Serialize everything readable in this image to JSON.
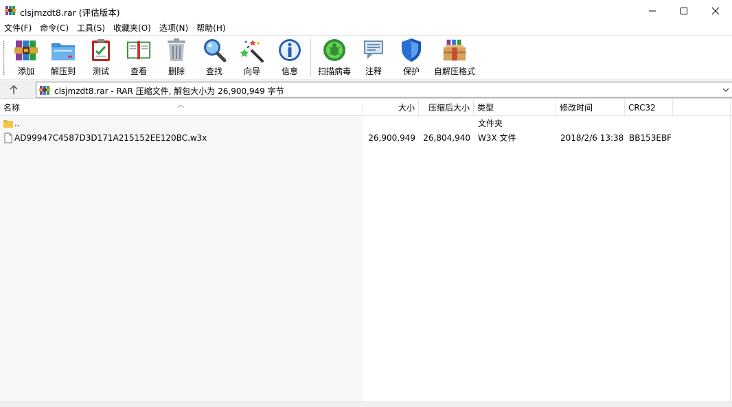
{
  "window": {
    "title": "clsjmzdt8.rar (评估版本)"
  },
  "menu": [
    {
      "label": "文件(F)"
    },
    {
      "label": "命令(C)"
    },
    {
      "label": "工具(S)"
    },
    {
      "label": "收藏夹(O)"
    },
    {
      "label": "选项(N)"
    },
    {
      "label": "帮助(H)"
    }
  ],
  "toolbar": {
    "buttons": [
      {
        "label": "添加",
        "icon": "add-archive-icon"
      },
      {
        "label": "解压到",
        "icon": "extract-folder-icon"
      },
      {
        "label": "测试",
        "icon": "test-clipboard-icon"
      },
      {
        "label": "查看",
        "icon": "view-book-icon"
      },
      {
        "label": "删除",
        "icon": "trash-icon"
      },
      {
        "label": "查找",
        "icon": "magnifier-icon"
      },
      {
        "label": "向导",
        "icon": "wizard-wand-icon"
      },
      {
        "label": "信息",
        "icon": "info-icon"
      },
      {
        "label": "扫描病毒",
        "icon": "virus-scan-icon"
      },
      {
        "label": "注释",
        "icon": "comment-icon"
      },
      {
        "label": "保护",
        "icon": "shield-icon"
      },
      {
        "label": "自解压格式",
        "icon": "sfx-box-icon"
      }
    ]
  },
  "address": {
    "text": "clsjmzdt8.rar - RAR 压缩文件, 解包大小为 26,900,949 字节"
  },
  "columns": {
    "name": "名称",
    "size": "大小",
    "packed": "压缩后大小",
    "type": "类型",
    "modified": "修改时间",
    "crc": "CRC32"
  },
  "rows": [
    {
      "name": "..",
      "size": "",
      "packed": "",
      "type": "文件夹",
      "modified": "",
      "crc": "",
      "icon": "folder-icon"
    },
    {
      "name": "AD99947C4587D3D171A215152EE120BC.w3x",
      "size": "26,900,949",
      "packed": "26,804,940",
      "type": "W3X 文件",
      "modified": "2018/2/6 13:38",
      "crc": "BB153EBF",
      "icon": "file-icon"
    }
  ],
  "colors": {
    "winrar_red": "#c0392b",
    "folder_yellow": "#f5c542",
    "accent_blue": "#2a6fd6"
  }
}
